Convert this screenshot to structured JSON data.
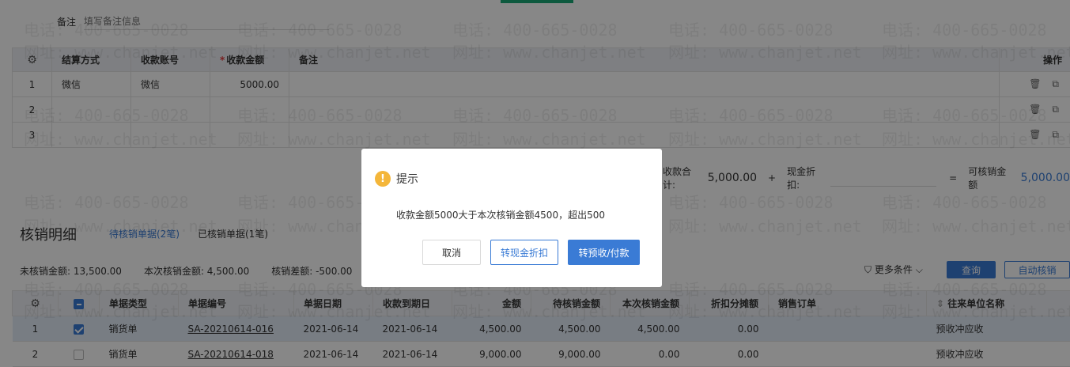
{
  "remark": {
    "label": "备注",
    "placeholder": "填写备注信息"
  },
  "settlement_table": {
    "headers": {
      "settle_method": "结算方式",
      "account": "收款账号",
      "amount": "收款金额",
      "required_mark": "*",
      "remark": "备注",
      "ops": "操作"
    },
    "rows": [
      {
        "idx": "1",
        "settle_method": "微信",
        "account": "微信",
        "amount": "5000.00",
        "remark": ""
      },
      {
        "idx": "2",
        "settle_method": "",
        "account": "",
        "amount": "",
        "remark": ""
      },
      {
        "idx": "3",
        "settle_method": "",
        "account": "",
        "amount": "",
        "remark": ""
      }
    ]
  },
  "summary": {
    "total_label": "收款合计:",
    "total_value": "5,000.00",
    "plus": "+",
    "discount_label": "现金折扣:",
    "equals": "=",
    "writeoff_label": "可核销金额",
    "writeoff_value": "5,000.00"
  },
  "detail": {
    "title": "核销明细",
    "tab_pending": "待核销单据(2笔)",
    "tab_done": "已核销单据(1笔)",
    "stats": {
      "unwritten": "未核销金额: 13,500.00",
      "current": "本次核销金额: 4,500.00",
      "diff": "核销差额: -500.00"
    },
    "more_filters": "更多条件",
    "query_button": "查询",
    "auto_button": "自动核销",
    "headers": {
      "doc_type": "单据类型",
      "doc_no": "单据编号",
      "doc_date": "单据日期",
      "due_date": "收款到期日",
      "amount": "金额",
      "pending": "待核销金额",
      "current": "本次核销金额",
      "discount": "折扣分摊额",
      "sales_order": "销售订单",
      "partner": "往来单位名称"
    },
    "rows": [
      {
        "idx": "1",
        "checked": true,
        "doc_type": "销货单",
        "doc_no": "SA-20210614-016",
        "doc_date": "2021-06-14",
        "due_date": "2021-06-14",
        "amount": "4,500.00",
        "pending": "4,500.00",
        "current": "4,500.00",
        "discount": "0.00",
        "sales_order": "",
        "partner": "预收冲应收"
      },
      {
        "idx": "2",
        "checked": false,
        "doc_type": "销货单",
        "doc_no": "SA-20210614-018",
        "doc_date": "2021-06-14",
        "due_date": "2021-06-14",
        "amount": "9,000.00",
        "pending": "9,000.00",
        "current": "0.00",
        "discount": "0.00",
        "sales_order": "",
        "partner": "预收冲应收"
      }
    ]
  },
  "watermark": {
    "phone": "电话: 400-665-0028",
    "site": "网址: www.chanjet.net"
  },
  "dialog": {
    "title": "提示",
    "message": "收款金额5000大于本次核销金额4500，超出500",
    "cancel": "取消",
    "to_cash_discount": "转现金折扣",
    "to_prepay": "转预收/付款"
  },
  "colors": {
    "primary": "#3a7bd5",
    "warning": "#f4b63a",
    "accent": "#1aa876"
  }
}
